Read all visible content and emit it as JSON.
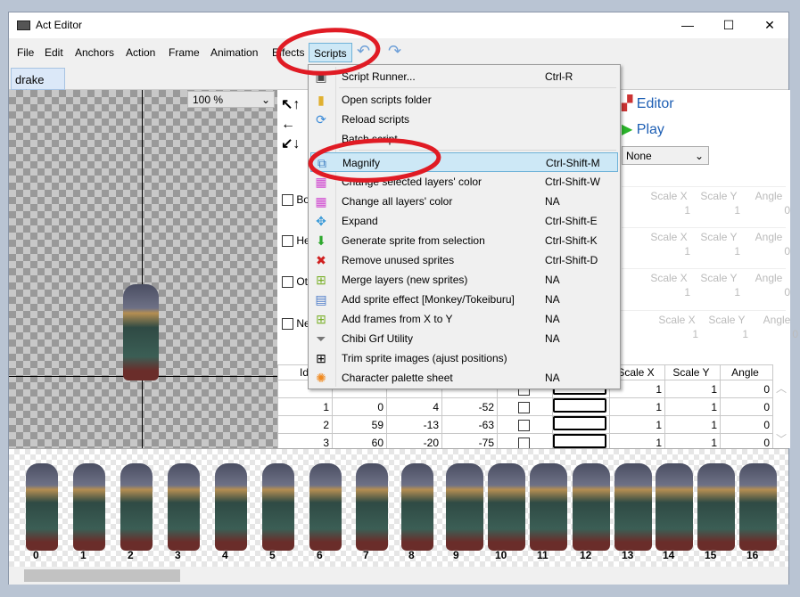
{
  "window": {
    "title": "Act Editor",
    "minimize": "—",
    "maximize": "☐",
    "close": "✕"
  },
  "menubar": [
    "File",
    "Edit",
    "Anchors",
    "Action",
    "Frame",
    "Animation",
    "Effects",
    "Scripts"
  ],
  "tab": {
    "label": "drake",
    "close": "✕"
  },
  "canvas": {
    "zoom": "100 %"
  },
  "right_panel": {
    "editor_label": "Editor",
    "play_label": "Play",
    "dropdown_value": "None",
    "layer_checks": [
      "Bo",
      "He",
      "Ot",
      "Ne"
    ],
    "disabled_headers": [
      "Scale X",
      "Scale Y",
      "Angle"
    ],
    "disabled_values": [
      "1",
      "1",
      "0"
    ]
  },
  "layer_table": {
    "headers": [
      "Id",
      "Scale X",
      "Scale Y",
      "Angle"
    ],
    "rows": [
      {
        "id": "",
        "a": "",
        "b": "",
        "c": "",
        "sx": "1",
        "sy": "1",
        "ang": "0"
      },
      {
        "id": "1",
        "a": "0",
        "b": "4",
        "c": "-52",
        "sx": "1",
        "sy": "1",
        "ang": "0"
      },
      {
        "id": "2",
        "a": "59",
        "b": "-13",
        "c": "-63",
        "sx": "1",
        "sy": "1",
        "ang": "0"
      },
      {
        "id": "3",
        "a": "60",
        "b": "-20",
        "c": "-75",
        "sx": "1",
        "sy": "1",
        "ang": "0"
      }
    ]
  },
  "scripts_menu": [
    {
      "label": "Script Runner...",
      "shortcut": "Ctrl-R",
      "icon": "terminal-icon"
    },
    {
      "label": "Open scripts folder",
      "shortcut": "",
      "icon": "folder-icon"
    },
    {
      "label": "Reload scripts",
      "shortcut": "",
      "icon": "reload-icon"
    },
    {
      "label": "Batch script",
      "shortcut": "",
      "icon": ""
    },
    {
      "label": "Magnify",
      "shortcut": "Ctrl-Shift-M",
      "icon": "magnify-icon"
    },
    {
      "label": "Change selected layers' color",
      "shortcut": "Ctrl-Shift-W",
      "icon": "palette-icon"
    },
    {
      "label": "Change all layers' color",
      "shortcut": "NA",
      "icon": "palette-icon"
    },
    {
      "label": "Expand",
      "shortcut": "Ctrl-Shift-E",
      "icon": "expand-icon"
    },
    {
      "label": "Generate sprite from selection",
      "shortcut": "Ctrl-Shift-K",
      "icon": "down-arrow-icon"
    },
    {
      "label": "Remove unused sprites",
      "shortcut": "Ctrl-Shift-D",
      "icon": "red-x-icon"
    },
    {
      "label": "Merge layers (new sprites)",
      "shortcut": "NA",
      "icon": "plus-icon"
    },
    {
      "label": "Add sprite effect [Monkey/Tokeiburu]",
      "shortcut": "NA",
      "icon": "effect-icon"
    },
    {
      "label": "Add frames from X to Y",
      "shortcut": "NA",
      "icon": "plus-icon"
    },
    {
      "label": "Chibi Grf Utility",
      "shortcut": "NA",
      "icon": "filter-icon"
    },
    {
      "label": "Trim sprite images (ajust positions)",
      "shortcut": "",
      "icon": "trim-icon"
    },
    {
      "label": "Character palette sheet",
      "shortcut": "NA",
      "icon": "sparkle-icon"
    }
  ],
  "frames": [
    "0",
    "1",
    "2",
    "3",
    "4",
    "5",
    "6",
    "7",
    "8",
    "9",
    "10",
    "11",
    "12",
    "13",
    "14",
    "15",
    "16"
  ],
  "colors": {
    "highlight": "#cde8f6",
    "annotation": "#e01b24",
    "link": "#1e5fb4"
  }
}
